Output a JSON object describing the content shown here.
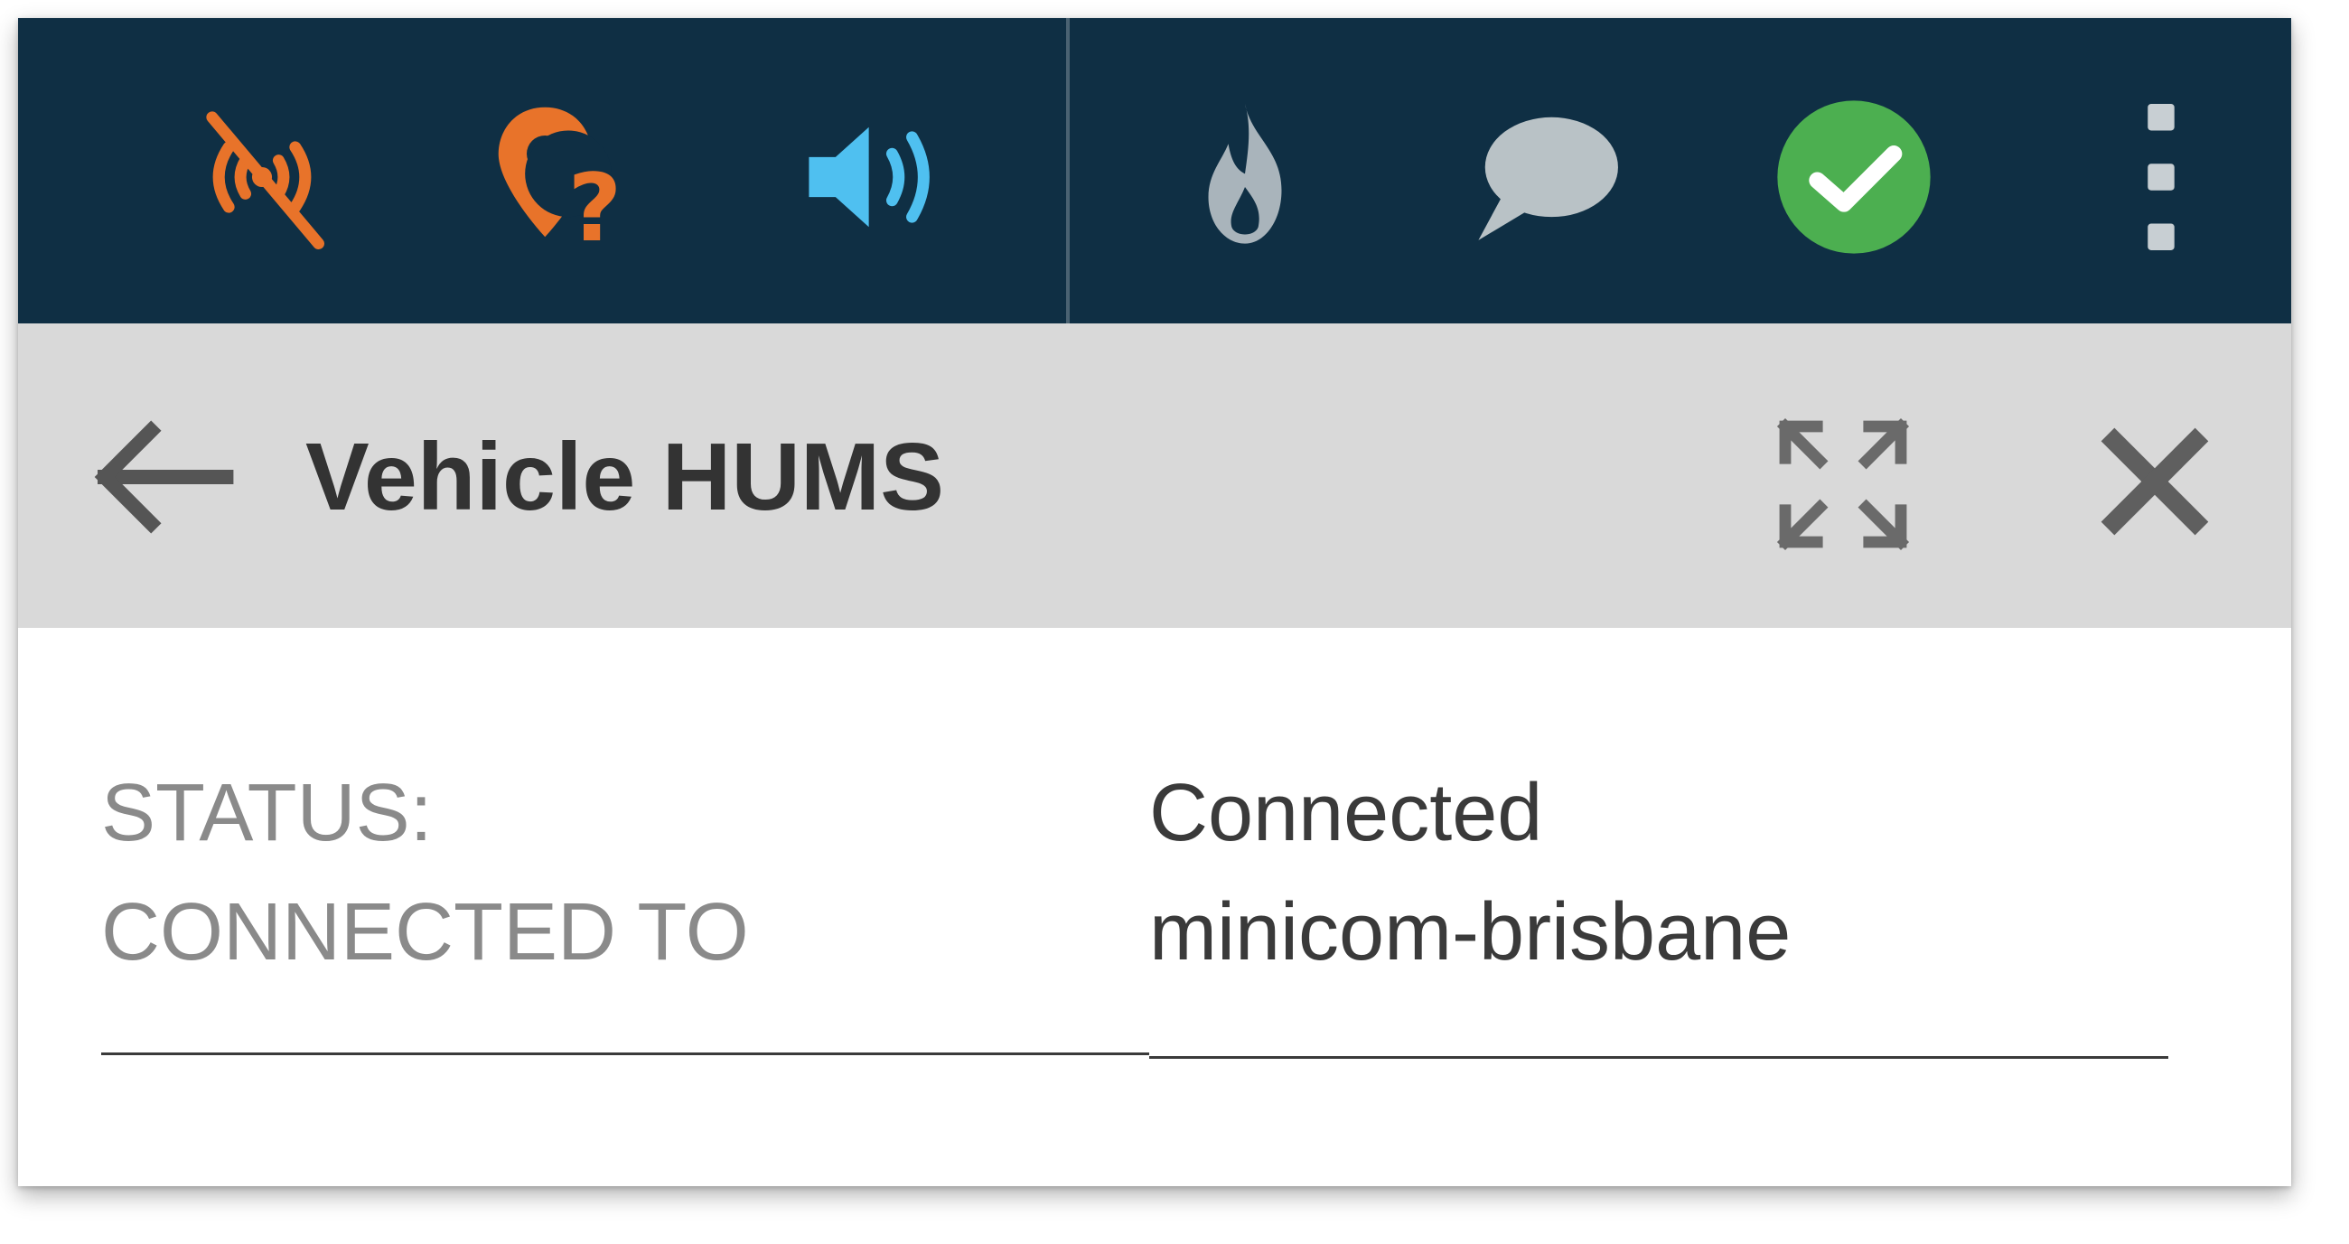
{
  "toolbar": {
    "left_icons": [
      {
        "name": "signal-off-icon",
        "color": "#e8732a"
      },
      {
        "name": "unknown-location-icon",
        "color": "#e8732a"
      },
      {
        "name": "volume-icon",
        "color": "#4fc0f0"
      }
    ],
    "right_icons": [
      {
        "name": "fire-icon",
        "color": "#a9b4bb"
      },
      {
        "name": "chat-icon",
        "color": "#b9c2c6"
      },
      {
        "name": "check-circle-icon",
        "color": "#4caf50"
      },
      {
        "name": "more-vertical-icon",
        "color": "#c8cfd3"
      }
    ],
    "background": "#0f2f44"
  },
  "header": {
    "title": "Vehicle HUMS",
    "back_icon": "arrow-left-icon",
    "expand_icon": "expand-icon",
    "close_icon": "close-icon",
    "background": "#d9d9d9"
  },
  "details": [
    {
      "label": "STATUS:",
      "value": "Connected"
    },
    {
      "label": "CONNECTED TO",
      "value": "minicom-brisbane"
    }
  ]
}
